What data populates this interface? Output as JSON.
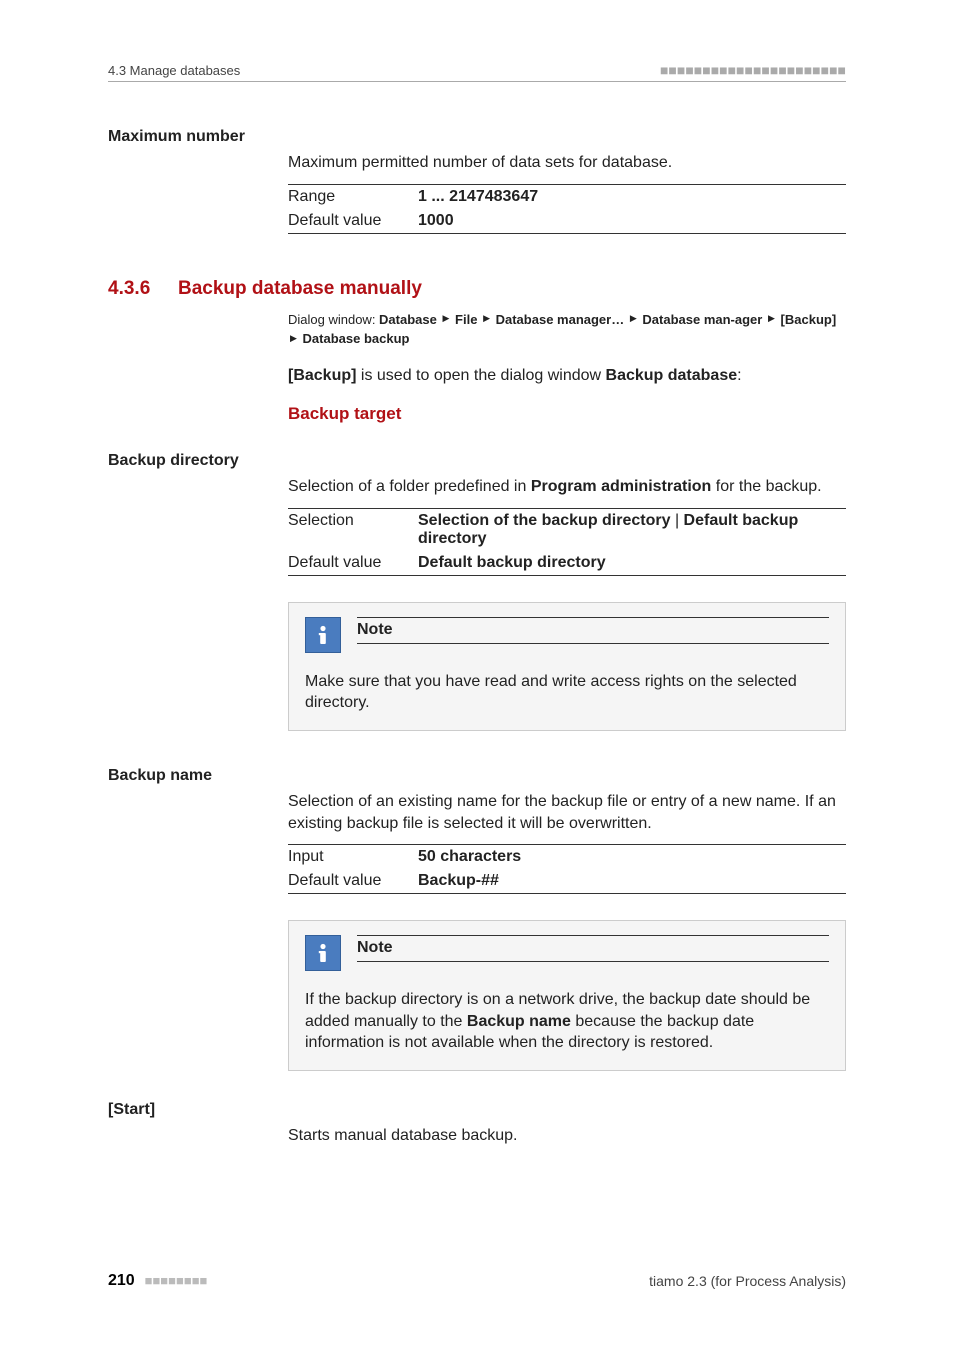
{
  "running_head": {
    "left": "4.3 Manage databases"
  },
  "maximum_number": {
    "label": "Maximum number",
    "desc": "Maximum permitted number of data sets for database.",
    "range_label": "Range",
    "range_value": "1 ... 2147483647",
    "default_label": "Default value",
    "default_value": "1000"
  },
  "h2": {
    "num": "4.3.6",
    "title": "Backup database manually"
  },
  "breadcrumb": {
    "prefix": "Dialog window: ",
    "parts": [
      "Database",
      "File",
      "Database manager…",
      "Database man-ager",
      "[Backup]",
      "Database backup"
    ]
  },
  "intro": {
    "pre": "",
    "bold1": "[Backup]",
    "mid": " is used to open the dialog window ",
    "bold2": "Backup database",
    "post": ":"
  },
  "red_sub": "Backup target",
  "backup_directory": {
    "label": "Backup directory",
    "desc_pre": "Selection of a folder predefined in ",
    "desc_bold": "Program administration",
    "desc_post": " for the backup.",
    "sel_label": "Selection",
    "sel_value_a": "Selection of the backup directory",
    "sel_value_sep": " | ",
    "sel_value_b": "Default backup directory",
    "def_label": "Default value",
    "def_value": "Default backup directory"
  },
  "note1": {
    "title": "Note",
    "body": "Make sure that you have read and write access rights on the selected directory."
  },
  "backup_name": {
    "label": "Backup name",
    "desc": "Selection of an existing name for the backup file or entry of a new name. If an existing backup file is selected it will be overwritten.",
    "input_label": "Input",
    "input_value": "50 characters",
    "def_label": "Default value",
    "def_value": "Backup-##"
  },
  "note2": {
    "title": "Note",
    "pre": "If the backup directory is on a network drive, the backup date should be added manually to the ",
    "bold": "Backup name",
    "post": " because the backup date information is not available when the directory is restored."
  },
  "start": {
    "label": "[Start]",
    "desc": "Starts manual database backup."
  },
  "footer": {
    "page": "210",
    "right": "tiamo 2.3 (for Process Analysis)"
  }
}
